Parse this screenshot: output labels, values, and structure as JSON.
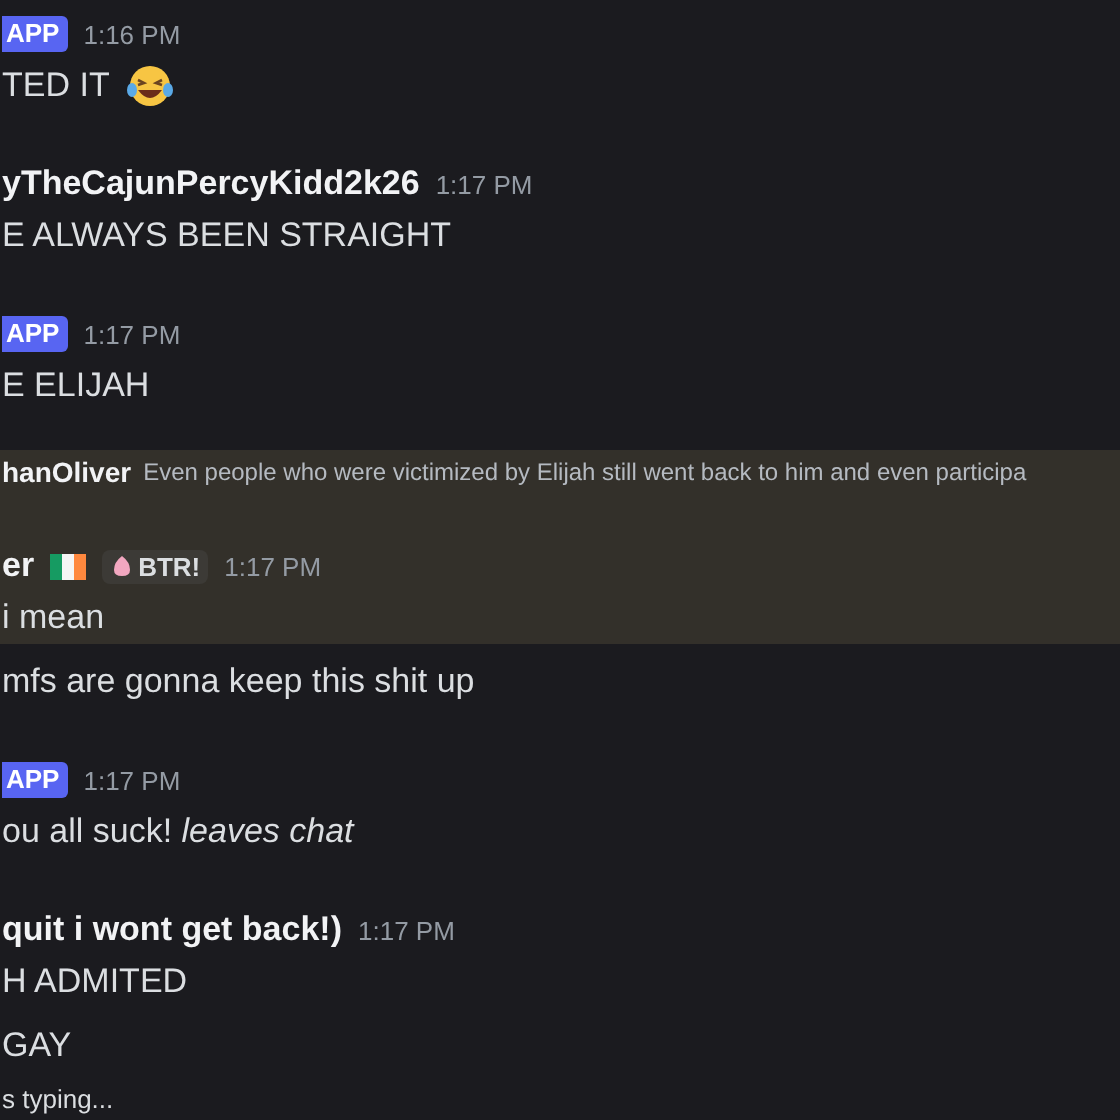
{
  "messages": [
    {
      "kind": "header",
      "highlighted": false,
      "badge": "APP",
      "time": "1:16 PM"
    },
    {
      "kind": "line",
      "highlighted": false,
      "text": "TED IT",
      "emoji": true
    },
    {
      "kind": "header",
      "highlighted": false,
      "name": "yTheCajunPercyKidd2k26",
      "time": "1:17 PM"
    },
    {
      "kind": "line",
      "highlighted": false,
      "text": "E ALWAYS BEEN STRAIGHT"
    },
    {
      "kind": "header",
      "highlighted": false,
      "badge": "APP",
      "time": "1:17 PM"
    },
    {
      "kind": "line",
      "highlighted": false,
      "text": "E ELIJAH"
    },
    {
      "kind": "reply",
      "highlighted": true,
      "name": "hanOliver",
      "text": "Even people who were victimized by Elijah still went back to him and even participa"
    },
    {
      "kind": "header",
      "highlighted": true,
      "name": "er",
      "flag": true,
      "tag": "BTR!",
      "time": "1:17 PM"
    },
    {
      "kind": "line",
      "highlighted": true,
      "text": "i mean"
    },
    {
      "kind": "line",
      "highlighted": false,
      "text": "mfs are gonna keep this shit up"
    },
    {
      "kind": "header",
      "highlighted": false,
      "badge": "APP",
      "time": "1:17 PM"
    },
    {
      "kind": "line",
      "highlighted": false,
      "text": "ou all suck! *leaves chat*"
    },
    {
      "kind": "header",
      "highlighted": false,
      "name": "quit i wont get back!)",
      "time": "1:17 PM"
    },
    {
      "kind": "line",
      "highlighted": false,
      "text": "H ADMITED"
    },
    {
      "kind": "line",
      "highlighted": false,
      "text": "GAY"
    },
    {
      "kind": "typing",
      "highlighted": false,
      "text": "s typing..."
    }
  ]
}
